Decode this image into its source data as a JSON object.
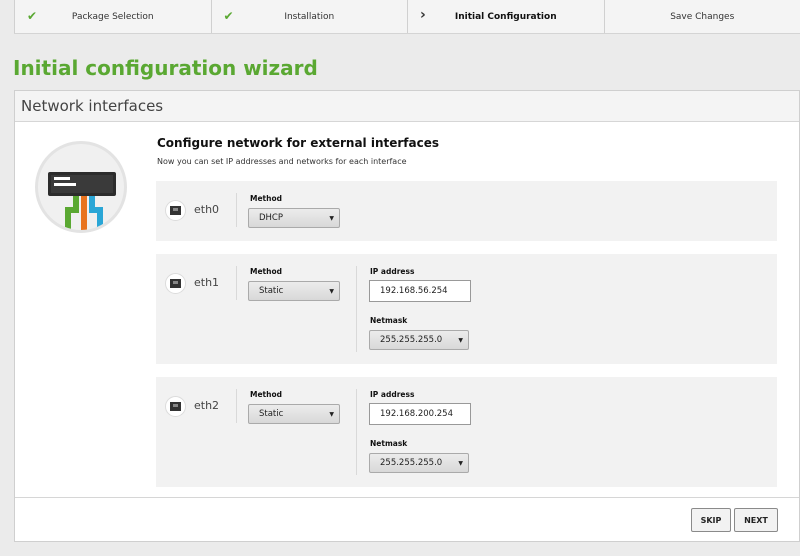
{
  "steps": [
    {
      "label": "Package Selection",
      "state": "done",
      "icon": "check-icon"
    },
    {
      "label": "Installation",
      "state": "done",
      "icon": "check-icon"
    },
    {
      "label": "Initial Configuration",
      "state": "active",
      "icon": "chevron-right-icon"
    },
    {
      "label": "Save Changes",
      "state": "pending"
    }
  ],
  "page_title": "Initial configuration wizard",
  "panel": {
    "heading": "Network interfaces",
    "section_title": "Configure network for external interfaces",
    "section_subtitle": "Now you can set IP addresses and networks for each interface",
    "illustration_icon": "network-switch-icon"
  },
  "labels": {
    "method": "Method",
    "ip_address": "IP address",
    "netmask": "Netmask"
  },
  "interfaces": [
    {
      "name": "eth0",
      "method": "DHCP"
    },
    {
      "name": "eth1",
      "method": "Static",
      "ip": "192.168.56.254",
      "netmask": "255.255.255.0"
    },
    {
      "name": "eth2",
      "method": "Static",
      "ip": "192.168.200.254",
      "netmask": "255.255.255.0"
    }
  ],
  "buttons": {
    "skip": "SKIP",
    "next": "NEXT"
  },
  "colors": {
    "accent_green": "#5aa832",
    "cable_green": "#5aa832",
    "cable_orange": "#e8731e",
    "cable_blue": "#2aa6d6"
  }
}
